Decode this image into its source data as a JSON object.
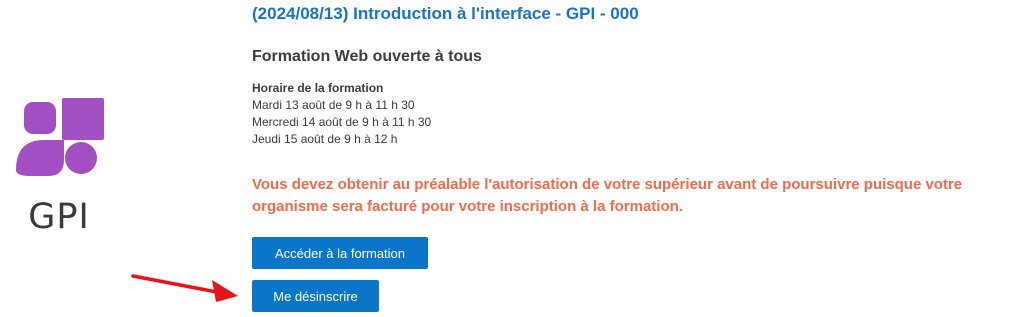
{
  "logo": {
    "text": "GPI",
    "icon": "gpi-logo-icon",
    "color": "#a24fc4"
  },
  "course": {
    "title": "(2024/08/13) Introduction à l'interface - GPI - 000",
    "subtitle": "Formation Web ouverte à tous",
    "schedule_heading": "Horaire de la formation",
    "schedule_lines": [
      "Mardi 13 août de 9 h à 11 h 30",
      "Mercredi 14 août de 9 h à 11 h 30",
      "Jeudi 15 août de 9 h à 12 h"
    ],
    "warning": "Vous devez obtenir au préalable l'autorisation de votre supérieur avant de poursuivre puisque votre organisme sera facturé pour votre inscription à la formation."
  },
  "actions": {
    "access_label": "Accéder à la formation",
    "unsubscribe_label": "Me désinscrire"
  },
  "colors": {
    "title": "#1a73c8",
    "warning": "#f26b4a",
    "button": "#0b76c9",
    "arrow": "#e8141b"
  }
}
